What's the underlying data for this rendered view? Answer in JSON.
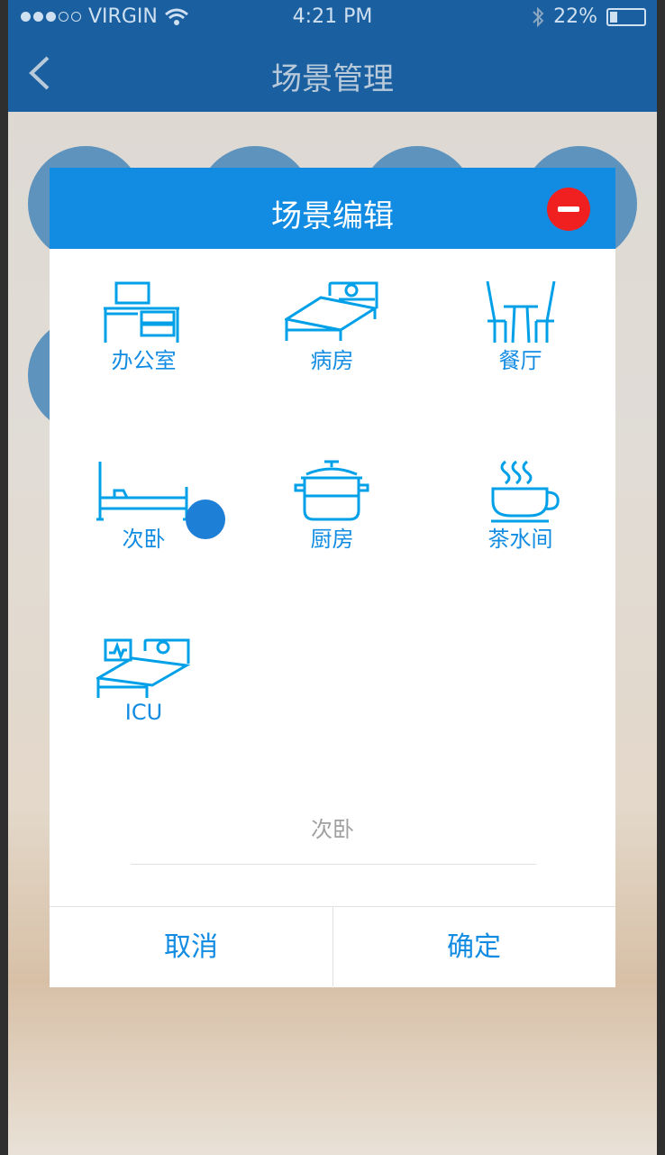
{
  "status": {
    "carrier": "VIRGIN",
    "time": "4:21 PM",
    "battery": "22%",
    "battery_level": 0.22
  },
  "nav": {
    "title": "场景管理"
  },
  "dialog": {
    "title": "场景编辑",
    "scenes": [
      {
        "label": "办公室",
        "icon": "office-desk-icon"
      },
      {
        "label": "病房",
        "icon": "ward-bed-icon"
      },
      {
        "label": "餐厅",
        "icon": "dining-table-icon"
      },
      {
        "label": "次卧",
        "icon": "secondary-bedroom-icon",
        "selected": true
      },
      {
        "label": "厨房",
        "icon": "cooking-pot-icon"
      },
      {
        "label": "茶水间",
        "icon": "tea-cup-icon"
      },
      {
        "label": "ICU",
        "icon": "icu-bed-icon"
      }
    ],
    "selected_name": "次卧",
    "cancel_label": "取消",
    "confirm_label": "确定"
  },
  "colors": {
    "primary": "#128ce3",
    "icon": "#00a0e9",
    "preview_text": "#a0a0a0",
    "divider": "#e2e2e2"
  }
}
